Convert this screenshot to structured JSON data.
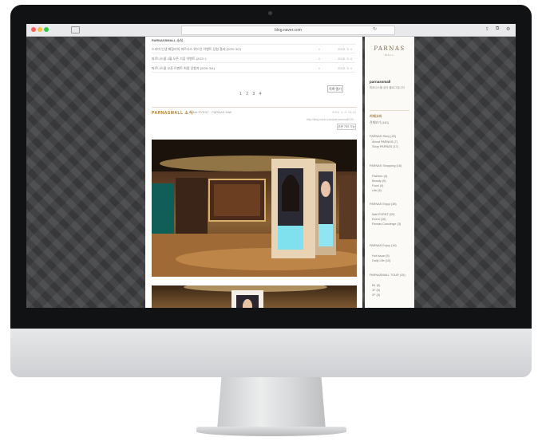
{
  "browser": {
    "url": "blog.naver.com"
  },
  "recent_posts": [
    {
      "title": "PARNASSMALL 소식",
      "n": "",
      "date": ""
    },
    {
      "title": "드라마 인생 패밀리의 파르나스 위드인 이벤트 당첨 결과 (2/23~3/2)",
      "n": "0",
      "date": "2015. 3. 4"
    },
    {
      "title": "파르나스몰 3월 오픈 기념 이벤트 (2/23~)",
      "n": "0",
      "date": "2015. 3. 4"
    },
    {
      "title": "파르나스몰 오픈 이벤트 최종 당첨자 (2/25~3/1)",
      "n": "0",
      "date": "2015. 3. 4"
    }
  ],
  "pager": "1 2 3 4",
  "more_label": "목록 열기",
  "post": {
    "category": "PARNASMALL 소식",
    "subtitle": "Mall EVENT · PARNAS Mall",
    "date": "2015. 3. 9. 14:43",
    "url": "http://blog.naver.com/parnassmall/220...",
    "action": "본문 기타 기능"
  },
  "sidebar": {
    "brand": "PARNAS",
    "brand_sub": "MALL",
    "profile_name": "parnassmall",
    "profile_text": "파르나스몰 공식 블로그입니다",
    "category_head": "카테고리",
    "items": [
      "전체보기 (140)",
      "PARNAS Story (24)",
      "About PARNAS (7)",
      "Story PARNAS (17)",
      "PARNAS Shopping (18)",
      "Fashion (4)",
      "Beauty (5)",
      "Food (4)",
      "Life (5)",
      "PARNAS Enjoy (38)",
      "Mall EVENT (20)",
      "Event (18)",
      "Parnas Concierge (3)",
      "PARNAS Enjoy (15)",
      "Hot Issue (5)",
      "Daily Life (10)",
      "PARNASMALL TOUR (15)",
      "B1 (5)",
      "1F (5)",
      "2F (5)"
    ]
  },
  "colors": {
    "accent": "#b07a2f",
    "screen_bg": "#3e3f41",
    "bezel": "#111214"
  }
}
